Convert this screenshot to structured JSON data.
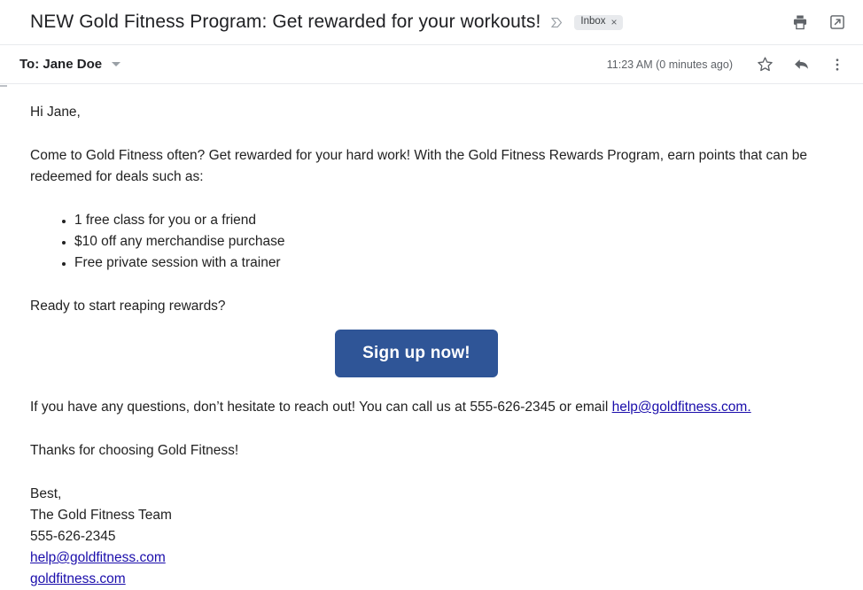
{
  "header": {
    "subject": "NEW Gold Fitness Program: Get rewarded for your workouts!",
    "important_marker_icon": "important-chevron-icon",
    "label_chip": {
      "text": "Inbox",
      "remove": "×"
    },
    "actions": {
      "print_icon": "print-icon",
      "open_new_window_icon": "open-in-new-window-icon"
    }
  },
  "recipient": {
    "to_label": "To: Jane Doe",
    "details_caret_icon": "chevron-down-icon",
    "timestamp": "11:23 AM (0 minutes ago)",
    "star_icon": "star-icon",
    "reply_icon": "reply-arrow-icon",
    "more_icon": "more-options-icon"
  },
  "message": {
    "greeting": "Hi Jane,",
    "intro": "Come to Gold Fitness often? Get rewarded for your hard work! With the Gold Fitness Rewards Program, earn points that can be redeemed for deals such as:",
    "perks": [
      "1 free class for you or a friend",
      "$10 off any merchandise purchase",
      "Free private session with a trainer"
    ],
    "prompt": "Ready to start reaping rewards?",
    "cta_label": "Sign up now!",
    "cta_color": "#2f5597",
    "contact_prefix": "If you have any questions, don’t hesitate to reach out! You can call us at 555-626-2345 or email ",
    "contact_email_link": "help@goldfitness.com.",
    "thanks": "Thanks for choosing Gold Fitness!",
    "signature": {
      "closing": "Best,",
      "team": "The Gold Fitness Team",
      "phone": "555-626-2345",
      "email": "help@goldfitness.com",
      "website": "goldfitness.com"
    },
    "link_color": "#1a0dab"
  }
}
